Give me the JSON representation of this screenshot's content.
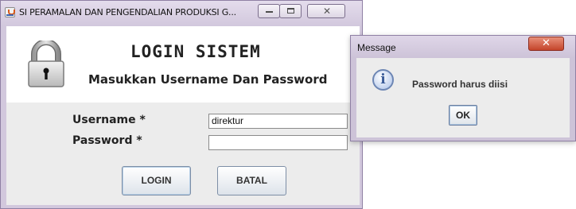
{
  "login_window": {
    "title": "SI PERAMALAN DAN PENGENDALIAN PRODUKSI G...",
    "heading": "LOGIN SISTEM",
    "subheading": "Masukkan Username Dan Password",
    "username_label": "Username *",
    "username_value": "direktur",
    "password_label": "Password *",
    "password_value": "",
    "login_button": "LOGIN",
    "cancel_button": "BATAL"
  },
  "message_dialog": {
    "title": "Message",
    "message": "Password harus diisi",
    "ok_button": "OK"
  },
  "colors": {
    "window_frame": "#d2c8dd",
    "panel_background": "#ececec",
    "close_button": "#c4452b"
  },
  "icons": {
    "app_icon": "java-cup-icon",
    "lock_icon": "padlock-icon",
    "info_icon": "information-icon"
  }
}
